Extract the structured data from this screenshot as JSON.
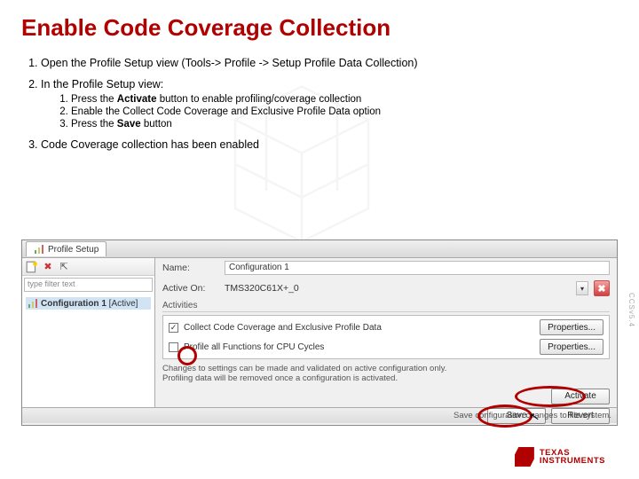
{
  "title": "Enable Code Coverage Collection",
  "steps": {
    "s1_pre": "Open the Profile Setup view (",
    "s1_menu": "Tools-> Profile -> Setup Profile Data Collection",
    "s1_post": ")",
    "s2": "In the Profile Setup view:",
    "s2a_pre": "Press the ",
    "s2a_b": "Activate",
    "s2a_post": " button to enable profiling/coverage collection",
    "s2b": "Enable the Collect Code Coverage and Exclusive Profile Data option",
    "s2c_pre": "Press the ",
    "s2c_b": "Save",
    "s2c_post": " button",
    "s3": "Code Coverage collection has been enabled"
  },
  "app": {
    "tab_title": "Profile Setup",
    "filter_placeholder": "type filter text",
    "tree_item": "Configuration 1",
    "tree_state": "[Active]",
    "name_label": "Name:",
    "name_value": "Configuration 1",
    "activeon_label": "Active On:",
    "activeon_value": "TMS320C61X+_0",
    "activities_header": "Activities",
    "act1": "Collect Code Coverage and Exclusive Profile Data",
    "act2": "Profile all Functions for CPU Cycles",
    "props_btn": "Properties...",
    "hint1": "Changes to settings can be made and validated on active configuration only.",
    "hint2": "Profiling data will be removed once a configuration is activated.",
    "activate_btn": "Activate",
    "save_btn": "Save",
    "revert_btn": "Revert",
    "status": "Save configuration changes to file system."
  },
  "brand": {
    "line1": "Texas",
    "line2": "Instruments"
  },
  "edge_text": "CCSv5.4"
}
